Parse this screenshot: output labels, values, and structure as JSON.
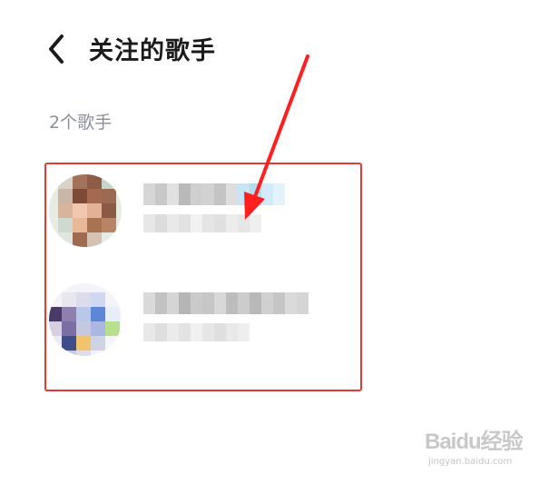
{
  "header": {
    "title": "关注的歌手",
    "back_icon": "chevron-left-icon"
  },
  "list": {
    "count_label": "2个歌手"
  },
  "colors": {
    "highlight": "#e53935",
    "title": "#1b1b1b",
    "secondary_text": "#8a8f99"
  },
  "watermark": {
    "logo": "Baidu经验",
    "url": "jingyan.baidu.com"
  }
}
